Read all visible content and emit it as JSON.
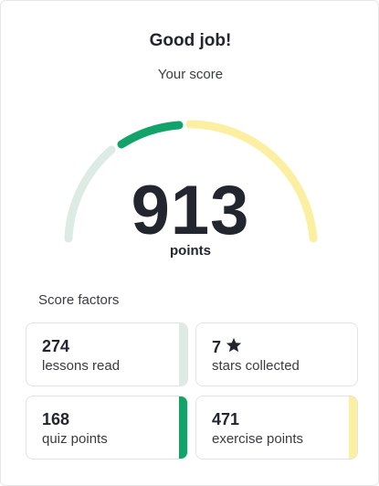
{
  "header": {
    "title": "Good job!",
    "subtitle": "Your score"
  },
  "score": {
    "value": "913",
    "unit": "points"
  },
  "gauge": {
    "segments": [
      {
        "name": "lessons",
        "color": "#dcebe3"
      },
      {
        "name": "quiz",
        "color": "#12a36a"
      },
      {
        "name": "exercise",
        "color": "#fbf0a2"
      }
    ]
  },
  "factors": {
    "label": "Score factors",
    "items": [
      {
        "value": "274",
        "label": "lessons read",
        "color": "#dcebe3"
      },
      {
        "value": "7",
        "label": "stars collected",
        "icon": "star-icon",
        "color": "#ffffff"
      },
      {
        "value": "168",
        "label": "quiz points",
        "color": "#12a36a"
      },
      {
        "value": "471",
        "label": "exercise points",
        "color": "#fbf0a2"
      }
    ]
  }
}
